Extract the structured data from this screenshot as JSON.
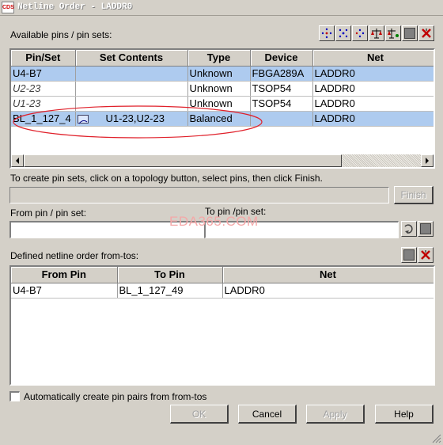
{
  "window": {
    "title": "Netline Order - LADDR0",
    "icon": "cds-app-icon"
  },
  "available": {
    "label": "Available pins / pin sets:",
    "toolbar_icons": [
      "pin-dots-icon-1",
      "pin-dots-icon-2",
      "pin-dots-icon-3",
      "balance-icon",
      "balance-pin-icon",
      "gray-square-icon",
      "red-x-icon"
    ],
    "columns": [
      "Pin/Set",
      "Set Contents",
      "Type",
      "Device",
      "Net"
    ],
    "rows": [
      {
        "pin": "U4-B7",
        "contents": "",
        "type": "Unknown",
        "device": "FBGA289A",
        "net": "LADDR0"
      },
      {
        "pin": "U2-23",
        "contents": "",
        "type": "Unknown",
        "device": "TSOP54",
        "net": "LADDR0"
      },
      {
        "pin": "U1-23",
        "contents": "",
        "type": "Unknown",
        "device": "TSOP54",
        "net": "LADDR0"
      },
      {
        "pin": "BL_1_127_4",
        "contents": "U1-23,U2-23",
        "type": "Balanced",
        "device": "",
        "net": "LADDR0"
      }
    ]
  },
  "instructions": "To create pin sets, click on a topology button, select pins, then click Finish.",
  "finish_label": "Finish",
  "from_label": "From pin / pin set:",
  "to_label": "To pin /pin set:",
  "from_value": "",
  "to_value": "",
  "watermark": "EDA365.COM",
  "defined": {
    "label": "Defined netline order from-tos:",
    "columns": [
      "From Pin",
      "To Pin",
      "Net"
    ],
    "rows": [
      {
        "from": "U4-B7",
        "to": "BL_1_127_49",
        "net": "LADDR0"
      }
    ]
  },
  "auto_checkbox": {
    "label": "Automatically create pin pairs from from-tos",
    "checked": false
  },
  "buttons": {
    "ok": "OK",
    "cancel": "Cancel",
    "apply": "Apply",
    "help": "Help"
  },
  "colors": {
    "selection": "#aecbef",
    "annotation": "#e0202a",
    "watermark": "#f4a8a8"
  }
}
